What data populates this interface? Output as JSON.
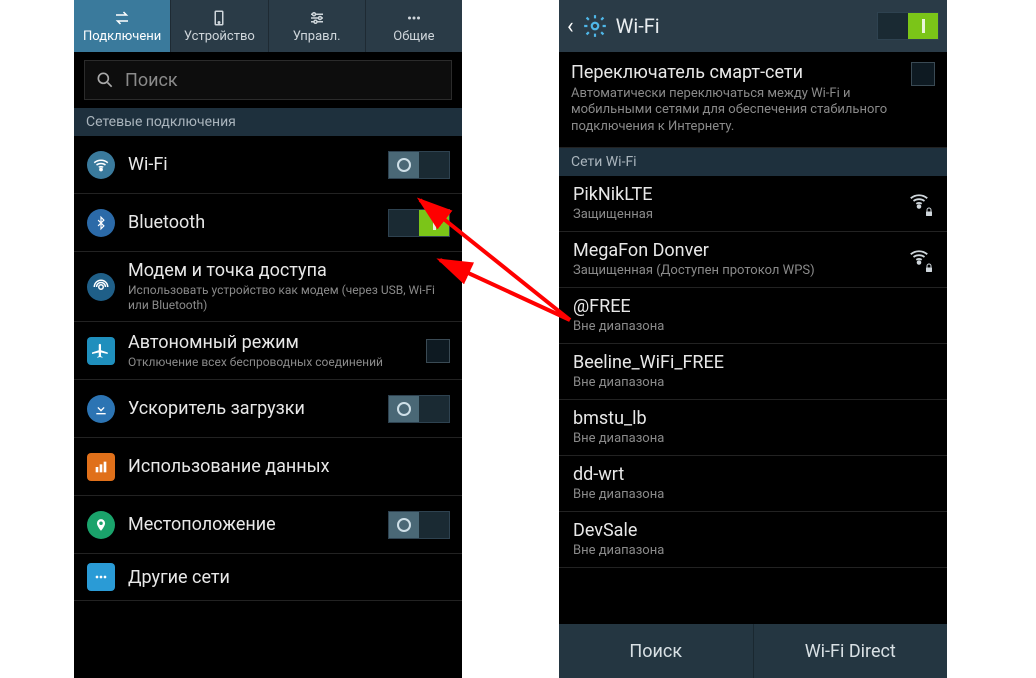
{
  "left": {
    "tabs": [
      {
        "label": "Подключени",
        "icon": "swap"
      },
      {
        "label": "Устройство",
        "icon": "phone"
      },
      {
        "label": "Управл.",
        "icon": "sliders"
      },
      {
        "label": "Общие",
        "icon": "dots"
      }
    ],
    "search_placeholder": "Поиск",
    "section_network": "Сетевые подключения",
    "rows": {
      "wifi": {
        "title": "Wi-Fi"
      },
      "bt": {
        "title": "Bluetooth"
      },
      "tether": {
        "title": "Модем и точка доступа",
        "sub": "Использовать устройство как модем (через USB, Wi-Fi или Bluetooth)"
      },
      "airplane": {
        "title": "Автономный режим",
        "sub": "Отключение всех беспроводных соединений"
      },
      "boost": {
        "title": "Ускоритель загрузки"
      },
      "data": {
        "title": "Использование данных"
      },
      "loc": {
        "title": "Местоположение"
      },
      "other": {
        "title": "Другие сети"
      }
    }
  },
  "right": {
    "title": "Wi-Fi",
    "smart": {
      "title": "Переключатель смарт-сети",
      "sub": "Автоматически переключаться между Wi-Fi и мобильными сетями для обеспечения стабильного подключения к Интернету."
    },
    "section_nets": "Сети Wi-Fi",
    "networks": [
      {
        "name": "PikNikLTE",
        "sub": "Защищенная",
        "signal": true,
        "lock": true
      },
      {
        "name": "MegaFon Donver",
        "sub": "Защищенная (Доступен протокол WPS)",
        "signal": true,
        "lock": true
      },
      {
        "name": "@FREE",
        "sub": "Вне диапазона"
      },
      {
        "name": "Beeline_WiFi_FREE",
        "sub": "Вне диапазона"
      },
      {
        "name": "bmstu_lb",
        "sub": "Вне диапазона"
      },
      {
        "name": "dd-wrt",
        "sub": "Вне диапазона"
      },
      {
        "name": "DevSale",
        "sub": "Вне диапазона"
      }
    ],
    "btn_search": "Поиск",
    "btn_direct": "Wi-Fi Direct"
  }
}
